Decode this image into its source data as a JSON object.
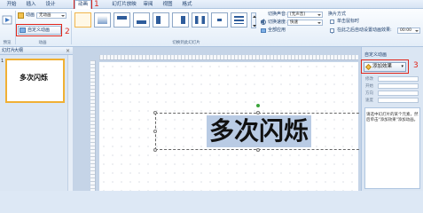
{
  "ribbon_tabs": [
    "开始",
    "插入",
    "设计",
    "动画",
    "幻灯片放映",
    "审阅",
    "视图",
    "格式"
  ],
  "active_tab": "动画",
  "animation_group": {
    "animate_label": "动画",
    "animate_value": "无动画",
    "custom_button": "自定义动画",
    "group_label": "动画"
  },
  "preview_label": "预览",
  "transition_group": {
    "group_label": "切换到此幻灯片",
    "sound_label": "切换声音:",
    "sound_value": "[无声音]",
    "speed_label": "切换速度:",
    "speed_value": "快速",
    "apply_all": "全部应用"
  },
  "advance": {
    "title": "换片方式",
    "on_click": "单击鼠标时",
    "after_label": "在此之后自动设置动画效果:",
    "after_value": "00:00"
  },
  "left_panel": {
    "tab_slides": "幻灯片",
    "tab_outline": "大纲",
    "slide_number": "1",
    "thumb_text": "多次闪烁"
  },
  "slide": {
    "title": "多次闪烁"
  },
  "right_pane": {
    "header": "自定义动画",
    "add_effect": "添加效果",
    "row1": "修改",
    "row2": "开始",
    "row3": "方向",
    "row4": "速度",
    "description": "请选中幻灯片的某个元素，然后单击\"添加效果\"添加动画。"
  },
  "annotations": [
    "1",
    "2",
    "3"
  ]
}
